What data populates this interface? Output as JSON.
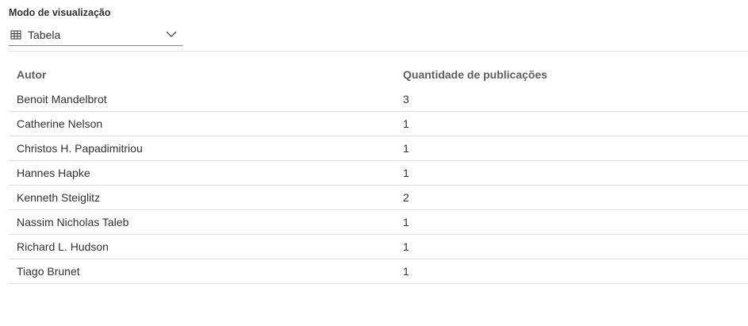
{
  "view_mode": {
    "label": "Modo de visualização",
    "selected": "Tabela",
    "icon": "table-icon"
  },
  "table": {
    "columns": [
      "Autor",
      "Quantidade de publicações"
    ],
    "rows": [
      {
        "author": "Benoit Mandelbrot",
        "count": "3"
      },
      {
        "author": "Catherine Nelson",
        "count": "1"
      },
      {
        "author": "Christos H. Papadimitriou",
        "count": "1"
      },
      {
        "author": "Hannes Hapke",
        "count": "1"
      },
      {
        "author": "Kenneth Steiglitz",
        "count": "2"
      },
      {
        "author": "Nassim Nicholas Taleb",
        "count": "1"
      },
      {
        "author": "Richard L. Hudson",
        "count": "1"
      },
      {
        "author": "Tiago Brunet",
        "count": "1"
      }
    ]
  }
}
